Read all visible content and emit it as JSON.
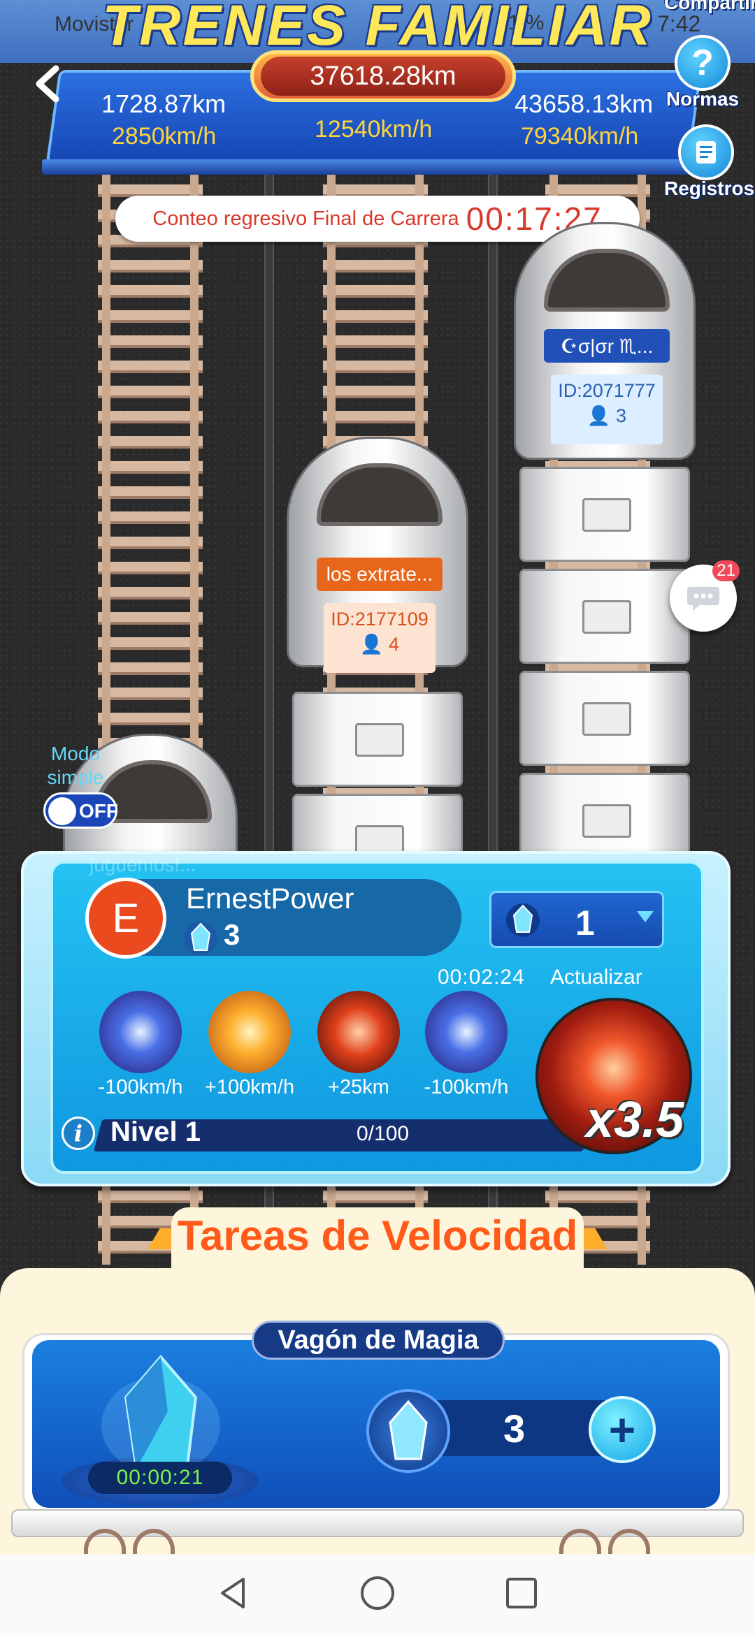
{
  "status_bar": {
    "carrier": "Movistar",
    "battery": "21 %",
    "time": "7:42"
  },
  "header": {
    "title": "TRENES FAMILIAR",
    "share_label": "Compartir",
    "total_distance": "37618.28km",
    "lanes": [
      {
        "distance": "1728.87km",
        "speed": "2850km/h"
      },
      {
        "distance": "",
        "speed": "12540km/h"
      },
      {
        "distance": "43658.13km",
        "speed": "79340km/h"
      }
    ],
    "rules_label": "Normas",
    "records_label": "Registros",
    "colors": {
      "title": "#ffe75a",
      "panel": "#1f5fd0"
    }
  },
  "countdown": {
    "label": "Conteo regresivo Final de Carrera",
    "time": "00:17:27"
  },
  "trains": [
    {
      "name": "jugeemos!...",
      "id": "",
      "members": ""
    },
    {
      "name": "los extrate...",
      "id": "ID:2177109",
      "members": "4",
      "tag_color": "#e8661c",
      "card_color": "#fde4d2",
      "text_color": "#d8501c"
    },
    {
      "name": "☪σ|σr ♏...",
      "id": "ID:2071777",
      "members": "3",
      "tag_color": "#2050b8",
      "card_color": "#dceeff",
      "text_color": "#2a5fb0"
    }
  ],
  "chat": {
    "badge": "21",
    "icon": "chat-bubble-icon"
  },
  "simple_mode": {
    "label": "Modo simple",
    "state": "OFF"
  },
  "player": {
    "watermark": "juguemos!...",
    "avatar_letter": "E",
    "name": "ErnestPower",
    "gems": "3",
    "select_value": "1",
    "refresh_timer": "00:02:24",
    "refresh_label": "Actualizar",
    "boosts": [
      {
        "label": "-100km/h",
        "icon": "blue-burst-icon"
      },
      {
        "label": "+100km/h",
        "icon": "orange-burst-icon"
      },
      {
        "label": "+25km",
        "icon": "red-coil-icon"
      },
      {
        "label": "-100km/h",
        "icon": "blue-burst-icon"
      }
    ],
    "multiplier": "x3.5",
    "level_label": "Nivel 1",
    "level_progress": "0/100",
    "level_fraction": 0.0
  },
  "tasks": {
    "title": "Tareas de Velocidad",
    "magic_wagon": {
      "title": "Vagón de Magia",
      "timer": "00:00:21",
      "gem_amount": "3"
    }
  }
}
